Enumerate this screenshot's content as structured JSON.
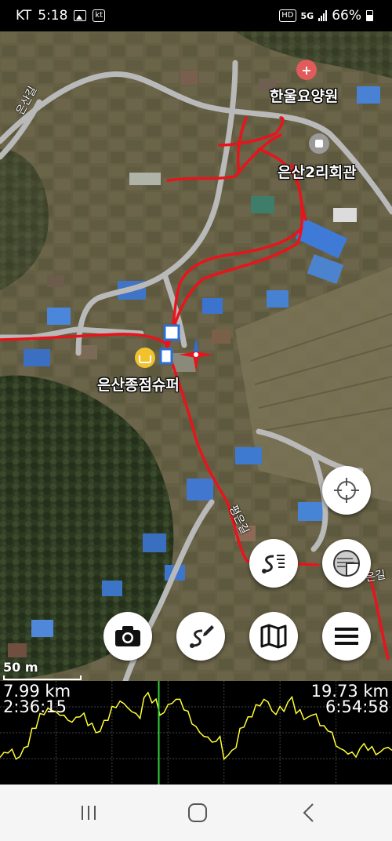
{
  "status_bar": {
    "carrier": "KT",
    "time": "5:18",
    "carrier_badge": "kt",
    "hd_badge": "HD",
    "network": "5G",
    "battery": "66%"
  },
  "map": {
    "places": {
      "nursing_home": "한울요양원",
      "village_hall": "은산2리회관",
      "store": "은산종점슈퍼"
    },
    "roads": {
      "road_1": "은산길",
      "road_2": "평은길",
      "road_3": "은길"
    },
    "scale": "50 m"
  },
  "profile": {
    "distance_current": "7.99 km",
    "time_current": "2:36:15",
    "distance_total": "19.73 km",
    "time_total": "6:54:58",
    "elevation_profile": [
      0.22,
      0.27,
      0.2,
      0.33,
      0.55,
      0.72,
      0.78,
      0.74,
      0.7,
      0.62,
      0.68,
      0.58,
      0.5,
      0.64,
      0.8,
      0.86,
      0.78,
      0.72,
      0.9,
      0.84,
      0.7,
      0.82,
      0.88,
      0.76,
      0.6,
      0.5,
      0.45,
      0.4,
      0.2,
      0.3,
      0.55,
      0.68,
      0.82,
      0.88,
      0.75,
      0.8,
      0.85,
      0.72,
      0.65,
      0.7,
      0.58,
      0.52,
      0.35,
      0.3,
      0.28,
      0.32,
      0.3,
      0.25,
      0.32,
      0.3
    ],
    "cursor_fraction": 0.405
  },
  "colors": {
    "track": "#e8141c",
    "profile_line": "#ffff33",
    "cursor": "#35d03a",
    "fab_bg": "#ffffff"
  },
  "buttons": {
    "locate": "crosshair-icon",
    "route_list": "route-list-icon",
    "layers": "layers-icon",
    "camera": "camera-icon",
    "edit_route": "edit-route-icon",
    "map": "map-icon",
    "menu": "menu-icon"
  }
}
